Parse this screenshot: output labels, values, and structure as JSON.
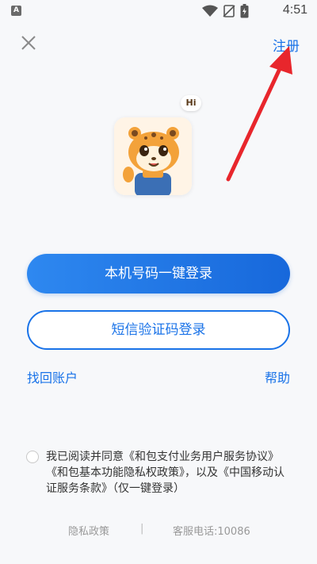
{
  "status_bar": {
    "app_indicator": "A",
    "time": "4:51",
    "icons": [
      "wifi-icon",
      "no-sim-icon",
      "battery-icon"
    ]
  },
  "header": {
    "close_icon": "close-icon",
    "register_label": "注册"
  },
  "avatar": {
    "badge_text": "Hi",
    "icon": "tiger-mascot"
  },
  "actions": {
    "one_click_login": "本机号码一键登录",
    "sms_login": "短信验证码登录",
    "recover_account": "找回账户",
    "help": "帮助"
  },
  "agreement": {
    "checked": false,
    "text": "我已阅读并同意《和包支付业务用户服务协议》《和包基本功能隐私权政策》，以及《中国移动认证服务条款》（仅一键登录）"
  },
  "footer": {
    "privacy": "隐私政策",
    "separator": "|",
    "hotline": "客服电话:10086"
  },
  "colors": {
    "accent": "#1a73e8",
    "arrow": "#e8262c",
    "background": "#f7f8fa"
  }
}
